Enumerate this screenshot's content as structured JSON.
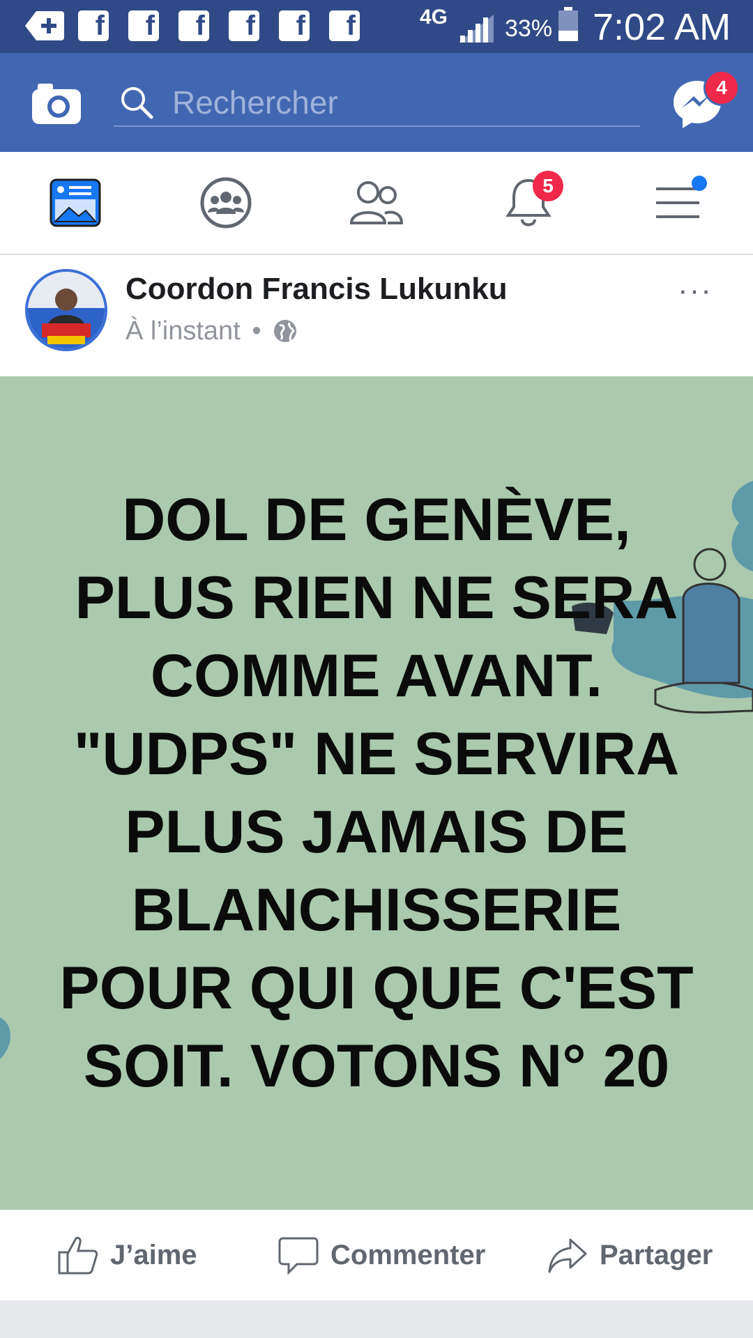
{
  "status_bar": {
    "network": "4G",
    "battery": "33%",
    "time": "7:02 AM",
    "notification_icons": [
      "add-icon",
      "facebook-icon",
      "facebook-icon",
      "facebook-icon",
      "facebook-icon",
      "facebook-icon",
      "facebook-icon"
    ]
  },
  "app_bar": {
    "search_placeholder": "Rechercher",
    "messenger_badge": "4"
  },
  "nav": {
    "notifications_badge": "5",
    "tabs": [
      "news-feed",
      "groups",
      "friends",
      "notifications",
      "menu"
    ]
  },
  "post": {
    "author": "Coordon Francis Lukunku",
    "time": "À l’instant",
    "separator": "•",
    "more": "···",
    "text_lines": [
      "DOL DE GENÈVE,",
      "PLUS RIEN NE SERA",
      "COMME AVANT.",
      "\"UDPS\" NE SERVIRA",
      "PLUS JAMAIS DE",
      "BLANCHISSERIE",
      "POUR QUI QUE C'EST",
      "SOIT. VOTONS N° 20"
    ],
    "background_color": "#aac9ae"
  },
  "actions": {
    "like": "J’aime",
    "comment": "Commenter",
    "share": "Partager"
  },
  "colors": {
    "brand": "#4267b2",
    "status_bar": "#2f4a86",
    "badge": "#f02849"
  }
}
